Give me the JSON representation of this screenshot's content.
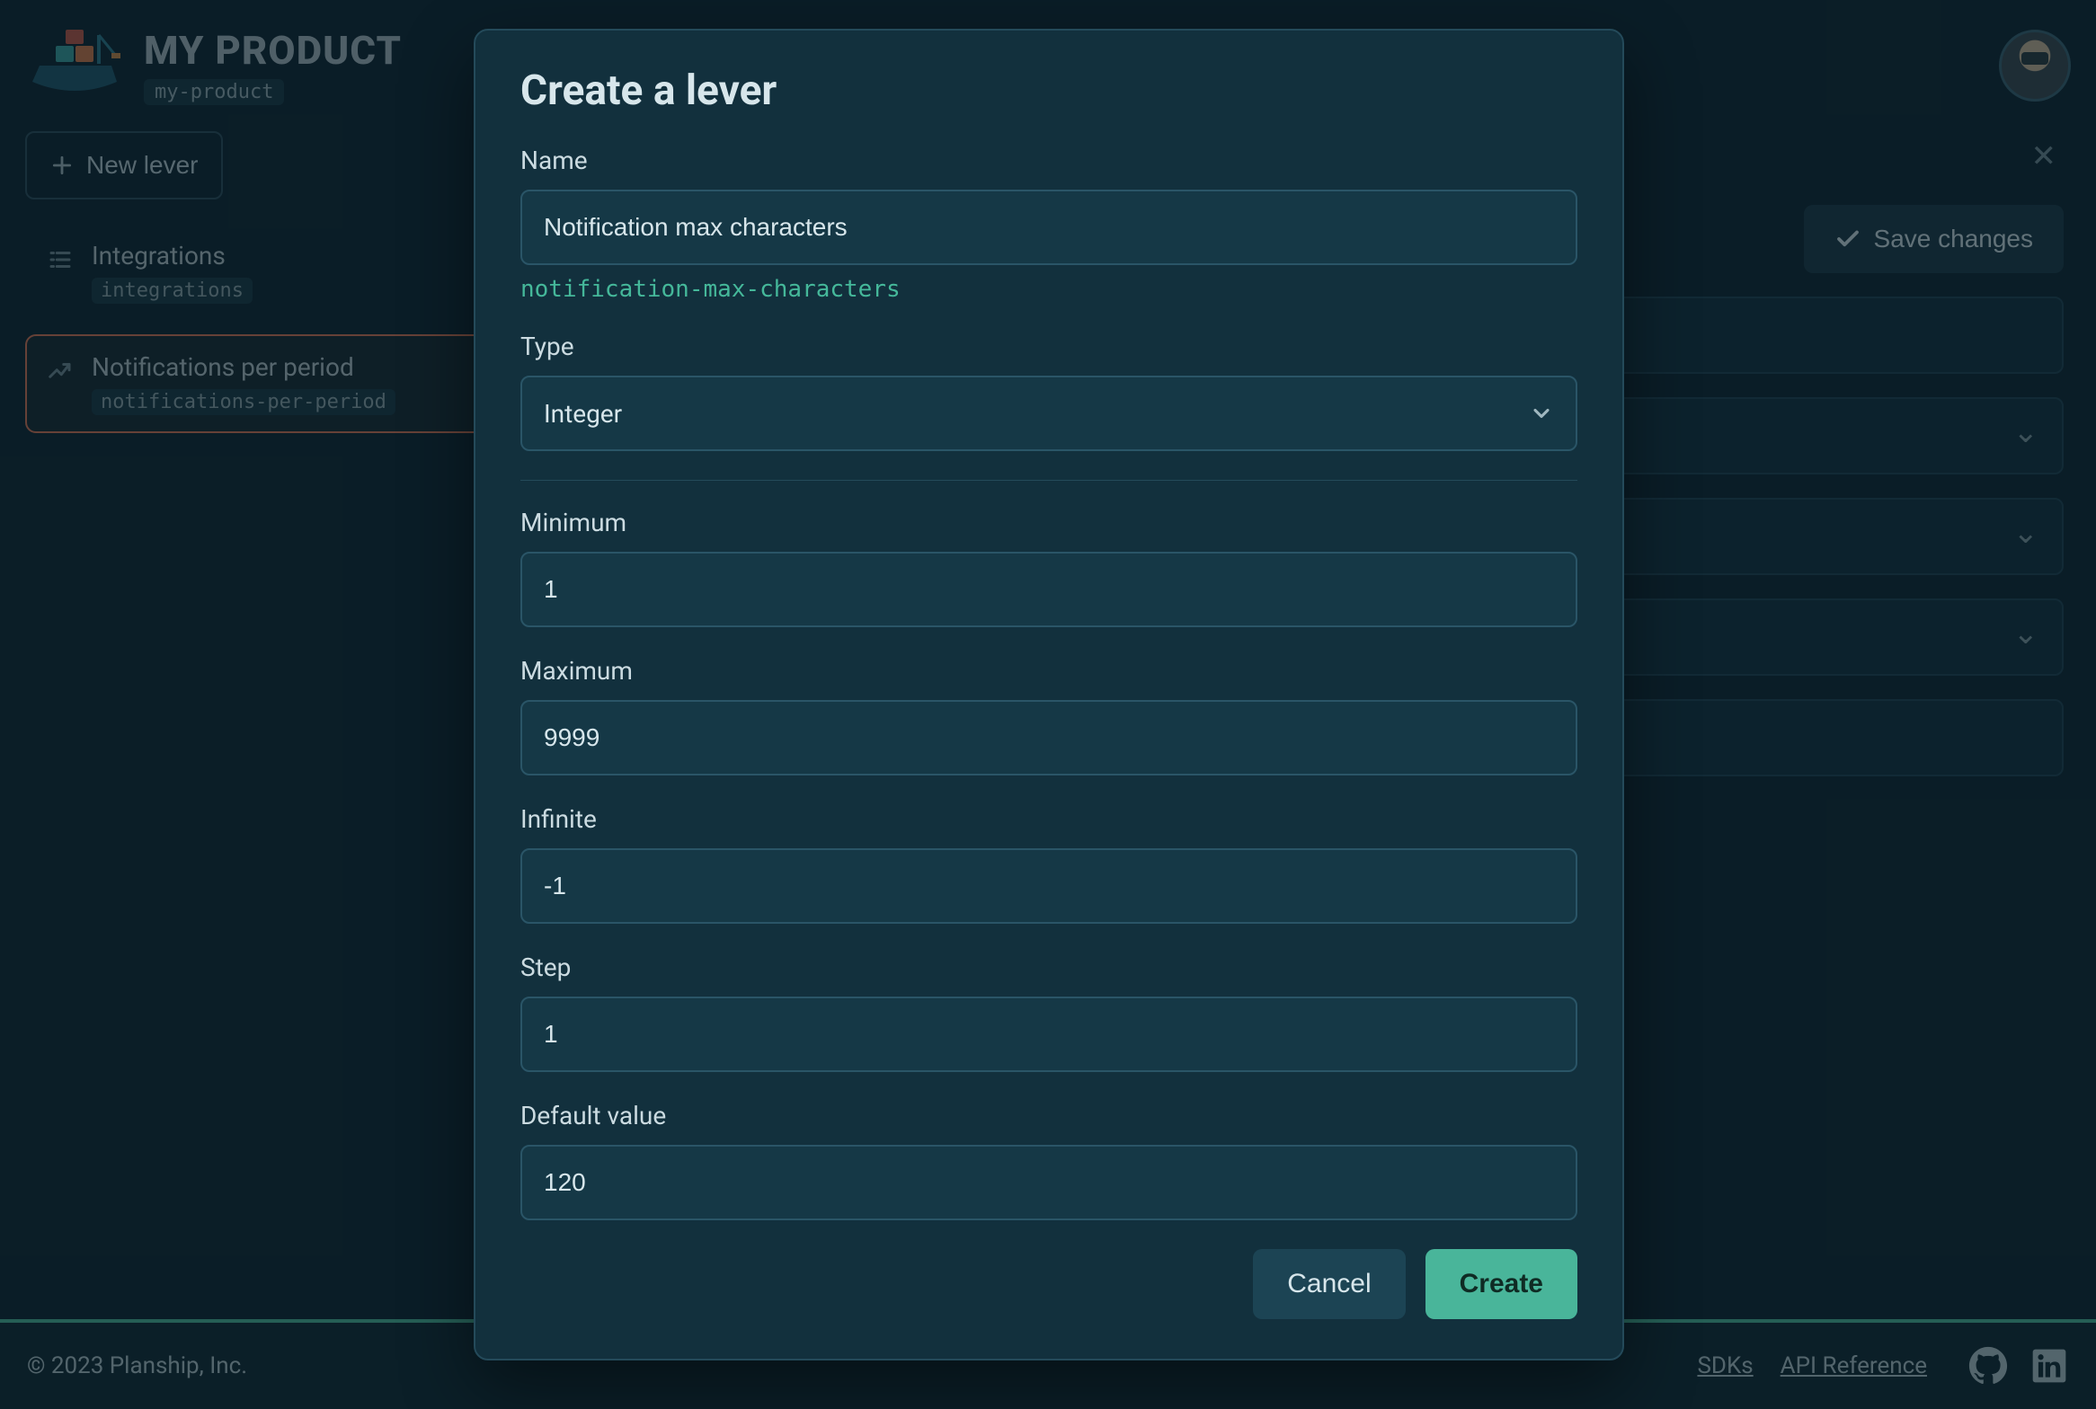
{
  "header": {
    "product_title": "MY PRODUCT",
    "product_slug": "my-product"
  },
  "sidebar": {
    "new_lever_label": "New lever",
    "items": [
      {
        "name": "Integrations",
        "slug": "integrations",
        "icon": "list-icon"
      },
      {
        "name": "Notifications per period",
        "slug": "notifications-per-period",
        "icon": "trend-icon"
      }
    ]
  },
  "main": {
    "save_label": "Save changes"
  },
  "modal": {
    "title": "Create a lever",
    "name_label": "Name",
    "name_value": "Notification max characters",
    "name_slug": "notification-max-characters",
    "type_label": "Type",
    "type_value": "Integer",
    "minimum_label": "Minimum",
    "minimum_value": "1",
    "maximum_label": "Maximum",
    "maximum_value": "9999",
    "infinite_label": "Infinite",
    "infinite_value": "-1",
    "step_label": "Step",
    "step_value": "1",
    "default_label": "Default value",
    "default_value": "120",
    "cancel_label": "Cancel",
    "create_label": "Create"
  },
  "footer": {
    "copyright": "© 2023 Planship, Inc.",
    "links": [
      "SDKs",
      "API Reference"
    ]
  }
}
